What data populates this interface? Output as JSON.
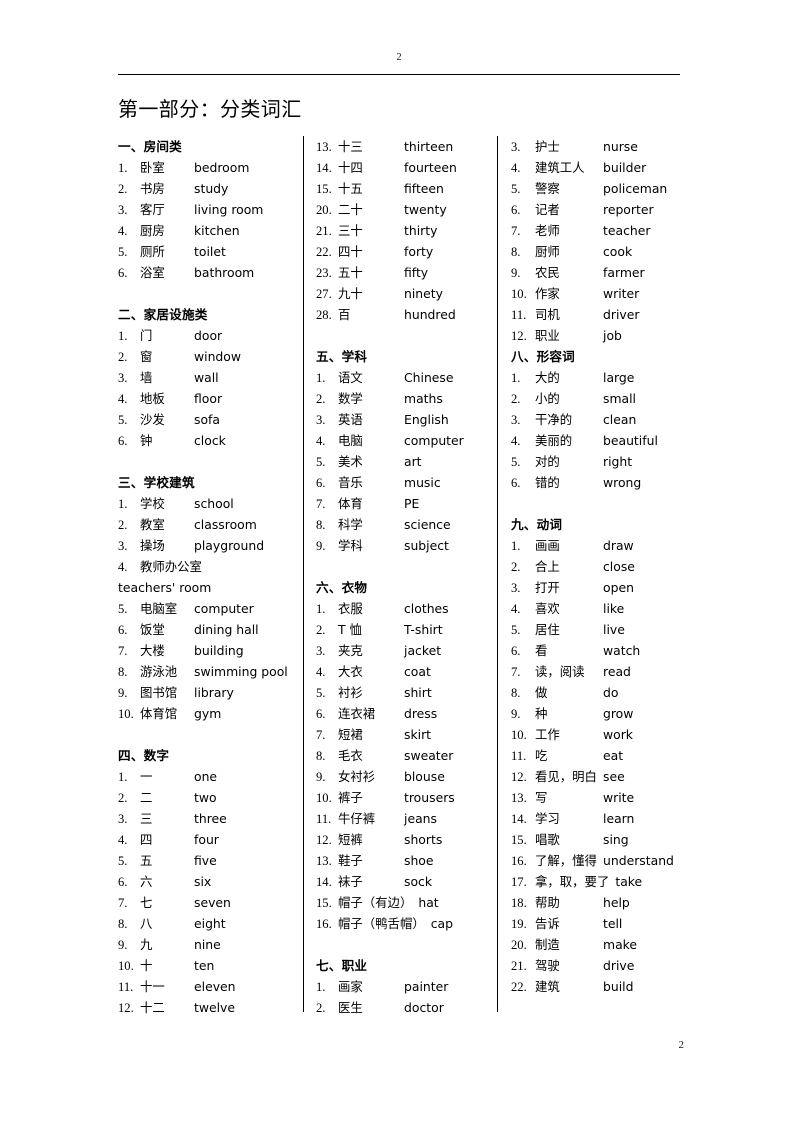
{
  "header": {
    "page_number": "2"
  },
  "footer": {
    "page_number": "2"
  },
  "title": "第一部分：分类词汇",
  "columns": [
    {
      "name": "column-1",
      "blocks": [
        {
          "type": "section",
          "heading": "一、房间类",
          "entries": [
            {
              "num": "1.",
              "zh": "卧室",
              "en": "bedroom"
            },
            {
              "num": "2.",
              "zh": "书房",
              "en": "study"
            },
            {
              "num": "3.",
              "zh": "客厅",
              "en": "living room"
            },
            {
              "num": "4.",
              "zh": "厨房",
              "en": "kitchen"
            },
            {
              "num": "5.",
              "zh": "厕所",
              "en": "toilet"
            },
            {
              "num": "6.",
              "zh": "浴室",
              "en": "bathroom"
            }
          ]
        },
        {
          "type": "spacer"
        },
        {
          "type": "section",
          "heading": "二、家居设施类",
          "entries": [
            {
              "num": "1.",
              "zh": "门",
              "en": "door"
            },
            {
              "num": "2.",
              "zh": "窗",
              "en": "window"
            },
            {
              "num": "3.",
              "zh": "墙",
              "en": "wall"
            },
            {
              "num": "4.",
              "zh": "地板",
              "en": "floor"
            },
            {
              "num": "5.",
              "zh": "沙发",
              "en": "sofa"
            },
            {
              "num": "6.",
              "zh": "钟",
              "en": "clock"
            }
          ]
        },
        {
          "type": "spacer"
        },
        {
          "type": "section",
          "heading": "三、学校建筑",
          "entries": [
            {
              "num": "1.",
              "zh": "学校",
              "en": "school"
            },
            {
              "num": "2.",
              "zh": "教室",
              "en": "classroom"
            },
            {
              "num": "3.",
              "zh": "操场",
              "en": "playground"
            },
            {
              "num": "4.",
              "zh": "教师办公室",
              "en": ""
            },
            {
              "continuation": "teachers' room"
            },
            {
              "num": "5.",
              "zh": "电脑室",
              "en": "computer"
            },
            {
              "num": "6.",
              "zh": "饭堂",
              "en": "dining hall"
            },
            {
              "num": "7.",
              "zh": "大楼",
              "en": "building"
            },
            {
              "num": "8.",
              "zh": "游泳池",
              "en": "swimming pool"
            },
            {
              "num": "9.",
              "zh": "图书馆",
              "en": "library"
            },
            {
              "num": "10.",
              "zh": "体育馆",
              "en": "gym"
            }
          ]
        },
        {
          "type": "spacer"
        },
        {
          "type": "section",
          "heading": "四、数字",
          "entries": [
            {
              "num": "1.",
              "zh": "一",
              "en": "one"
            },
            {
              "num": "2.",
              "zh": "二",
              "en": "two"
            },
            {
              "num": "3.",
              "zh": "三",
              "en": "three"
            },
            {
              "num": "4.",
              "zh": "四",
              "en": "four"
            },
            {
              "num": "5.",
              "zh": "五",
              "en": "five"
            },
            {
              "num": "6.",
              "zh": "六",
              "en": "six"
            },
            {
              "num": "7.",
              "zh": "七",
              "en": "seven"
            },
            {
              "num": "8.",
              "zh": "八",
              "en": "eight"
            },
            {
              "num": "9.",
              "zh": "九",
              "en": "nine"
            },
            {
              "num": "10.",
              "zh": "十",
              "en": "ten"
            },
            {
              "num": "11.",
              "zh": "十一",
              "en": "eleven"
            },
            {
              "num": "12.",
              "zh": "十二",
              "en": "twelve"
            }
          ]
        }
      ]
    },
    {
      "name": "column-2",
      "blocks": [
        {
          "type": "section",
          "heading": "",
          "entries": [
            {
              "num": "13.",
              "zh": "十三",
              "en": "thirteen"
            },
            {
              "num": "14.",
              "zh": "十四",
              "en": "fourteen"
            },
            {
              "num": "15.",
              "zh": "十五",
              "en": "fifteen"
            },
            {
              "num": "20.",
              "zh": "二十",
              "en": "twenty"
            },
            {
              "num": "21.",
              "zh": "三十",
              "en": "thirty"
            },
            {
              "num": "22.",
              "zh": "四十",
              "en": "forty"
            },
            {
              "num": "23.",
              "zh": "五十",
              "en": "fifty"
            },
            {
              "num": "27.",
              "zh": "九十",
              "en": "ninety"
            },
            {
              "num": "28.",
              "zh": "百",
              "en": "hundred"
            }
          ]
        },
        {
          "type": "spacer"
        },
        {
          "type": "section",
          "heading": "五、学科",
          "entries": [
            {
              "num": "1.",
              "zh": "语文",
              "en": "Chinese"
            },
            {
              "num": "2.",
              "zh": "数学",
              "en": "maths"
            },
            {
              "num": "3.",
              "zh": "英语",
              "en": "English"
            },
            {
              "num": "4.",
              "zh": "电脑",
              "en": "computer"
            },
            {
              "num": "5.",
              "zh": "美术",
              "en": "art"
            },
            {
              "num": "6.",
              "zh": "音乐",
              "en": "music"
            },
            {
              "num": "7.",
              "zh": "体育",
              "en": "PE"
            },
            {
              "num": "8.",
              "zh": "科学",
              "en": "science"
            },
            {
              "num": "9.",
              "zh": "学科",
              "en": "subject"
            }
          ]
        },
        {
          "type": "spacer"
        },
        {
          "type": "section",
          "heading": "六、衣物",
          "entries": [
            {
              "num": "1.",
              "zh": "衣服",
              "en": "clothes"
            },
            {
              "num": "2.",
              "zh": "T 恤",
              "en": "T-shirt"
            },
            {
              "num": "3.",
              "zh": "夹克",
              "en": "jacket"
            },
            {
              "num": "4.",
              "zh": "大衣",
              "en": "coat"
            },
            {
              "num": "5.",
              "zh": "衬衫",
              "en": "shirt"
            },
            {
              "num": "6.",
              "zh": "连衣裙",
              "en": "dress"
            },
            {
              "num": "7.",
              "zh": "短裙",
              "en": "skirt"
            },
            {
              "num": "8.",
              "zh": "毛衣",
              "en": "sweater"
            },
            {
              "num": "9.",
              "zh": "女衬衫",
              "en": "blouse"
            },
            {
              "num": "10.",
              "zh": "裤子",
              "en": "trousers"
            },
            {
              "num": "11.",
              "zh": "牛仔裤",
              "en": "jeans"
            },
            {
              "num": "12.",
              "zh": "短裤",
              "en": "shorts"
            },
            {
              "num": "13.",
              "zh": "鞋子",
              "en": "shoe"
            },
            {
              "num": "14.",
              "zh": "袜子",
              "en": "sock"
            },
            {
              "num": "15.",
              "zh": "帽子（有边）",
              "en": "hat"
            },
            {
              "num": "16.",
              "zh": "帽子（鸭舌帽）",
              "en": "cap"
            }
          ]
        },
        {
          "type": "spacer"
        },
        {
          "type": "section",
          "heading": "七、职业",
          "entries": [
            {
              "num": "1.",
              "zh": "画家",
              "en": "painter"
            },
            {
              "num": "2.",
              "zh": "医生",
              "en": "doctor"
            }
          ]
        }
      ]
    },
    {
      "name": "column-3",
      "blocks": [
        {
          "type": "section",
          "heading": "",
          "entries": [
            {
              "num": "3.",
              "zh": "护士",
              "en": "nurse"
            },
            {
              "num": "4.",
              "zh": "建筑工人",
              "en": "builder"
            },
            {
              "num": "5.",
              "zh": "警察",
              "en": "policeman"
            },
            {
              "num": "6.",
              "zh": "记者",
              "en": "reporter"
            },
            {
              "num": "7.",
              "zh": "老师",
              "en": "teacher"
            },
            {
              "num": "8.",
              "zh": "厨师",
              "en": "cook"
            },
            {
              "num": "9.",
              "zh": "农民",
              "en": "farmer"
            },
            {
              "num": "10.",
              "zh": "作家",
              "en": "writer"
            },
            {
              "num": "11.",
              "zh": "司机",
              "en": "driver"
            },
            {
              "num": "12.",
              "zh": "职业",
              "en": "job"
            }
          ]
        },
        {
          "type": "section",
          "heading": "八、形容词",
          "entries": [
            {
              "num": "1.",
              "zh": "大的",
              "en": "large"
            },
            {
              "num": "2.",
              "zh": "小的",
              "en": "small"
            },
            {
              "num": "3.",
              "zh": "干净的",
              "en": "clean"
            },
            {
              "num": "4.",
              "zh": "美丽的",
              "en": "beautiful"
            },
            {
              "num": "5.",
              "zh": "对的",
              "en": "right"
            },
            {
              "num": "6.",
              "zh": "错的",
              "en": "wrong"
            }
          ]
        },
        {
          "type": "spacer"
        },
        {
          "type": "section",
          "heading": "九、动词",
          "entries": [
            {
              "num": "1.",
              "zh": "画画",
              "en": "draw"
            },
            {
              "num": "2.",
              "zh": "合上",
              "en": "close"
            },
            {
              "num": "3.",
              "zh": "打开",
              "en": "open"
            },
            {
              "num": "4.",
              "zh": "喜欢",
              "en": "like"
            },
            {
              "num": "5.",
              "zh": "居住",
              "en": "live"
            },
            {
              "num": "6.",
              "zh": "看",
              "en": "watch"
            },
            {
              "num": "7.",
              "zh": "读，阅读",
              "en": "read"
            },
            {
              "num": "8.",
              "zh": "做",
              "en": "do"
            },
            {
              "num": "9.",
              "zh": "种",
              "en": "grow"
            },
            {
              "num": "10.",
              "zh": "工作",
              "en": "work"
            },
            {
              "num": "11.",
              "zh": "吃",
              "en": "eat"
            },
            {
              "num": "12.",
              "zh": "看见，明白",
              "en": "see"
            },
            {
              "num": "13.",
              "zh": "写",
              "en": "write"
            },
            {
              "num": "14.",
              "zh": "学习",
              "en": "learn"
            },
            {
              "num": "15.",
              "zh": "唱歌",
              "en": "sing"
            },
            {
              "num": "16.",
              "zh": "了解，懂得",
              "en": "understand"
            },
            {
              "num": "17.",
              "zh": "拿，取，要了",
              "en": "take"
            },
            {
              "num": "18.",
              "zh": "帮助",
              "en": "help"
            },
            {
              "num": "19.",
              "zh": "告诉",
              "en": "tell"
            },
            {
              "num": "20.",
              "zh": "制造",
              "en": "make"
            },
            {
              "num": "21.",
              "zh": "驾驶",
              "en": "drive"
            },
            {
              "num": "22.",
              "zh": "建筑",
              "en": "build"
            }
          ]
        }
      ]
    }
  ]
}
